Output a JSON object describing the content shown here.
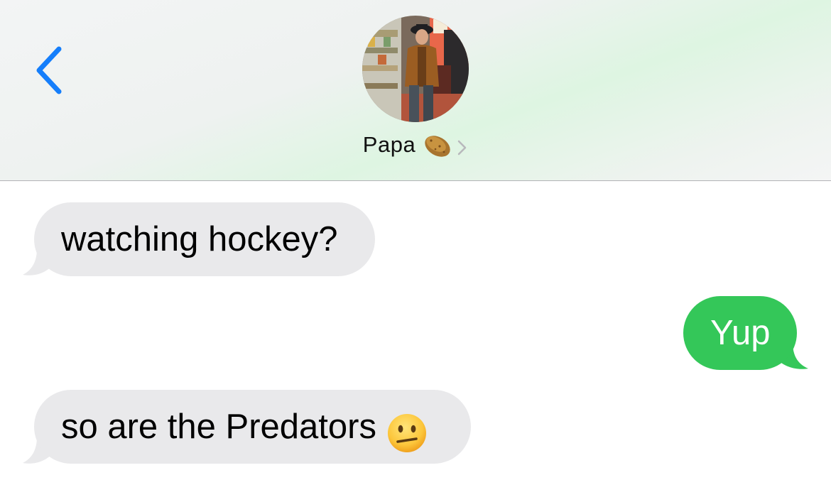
{
  "contact": {
    "name": "Papa",
    "name_emoji": "potato-icon"
  },
  "colors": {
    "outgoing_bubble": "#34c759",
    "incoming_bubble": "#e9e9eb",
    "accent": "#157efb"
  },
  "messages": [
    {
      "direction": "incoming",
      "text": "watching hockey?"
    },
    {
      "direction": "outgoing",
      "text": "Yup"
    },
    {
      "direction": "incoming",
      "text": "so are the Predators",
      "emoji": "neutral-face-icon"
    }
  ]
}
